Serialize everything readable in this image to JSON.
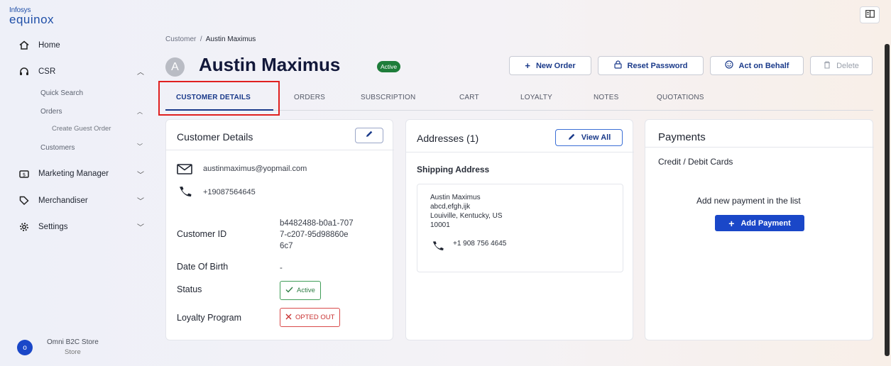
{
  "brand": {
    "line1": "Infosys",
    "line2": "equinox"
  },
  "sidebar": {
    "items": [
      {
        "label": "Home"
      },
      {
        "label": "CSR"
      },
      {
        "label": "Marketing Manager"
      },
      {
        "label": "Merchandiser"
      },
      {
        "label": "Settings"
      }
    ],
    "sub_items": [
      {
        "label": "Quick Search"
      },
      {
        "label": "Orders"
      },
      {
        "label": "Create Guest Order"
      },
      {
        "label": "Customers"
      }
    ],
    "store": {
      "initial": "o",
      "name": "Omni B2C Store",
      "type": "Store"
    }
  },
  "header": {
    "breadcrumb_root": "Customer",
    "breadcrumb_sep": "/",
    "breadcrumb_current": "Austin Maximus",
    "avatar_initial": "A",
    "customer_name": "Austin Maximus",
    "status_badge": "Active",
    "buttons": {
      "new_order": "New Order",
      "reset_password": "Reset Password",
      "act_on_behalf": "Act on Behalf",
      "delete": "Delete"
    }
  },
  "tabs": [
    {
      "label": "CUSTOMER DETAILS",
      "selected": true
    },
    {
      "label": "ORDERS"
    },
    {
      "label": "SUBSCRIPTION"
    },
    {
      "label": "CART"
    },
    {
      "label": "LOYALTY"
    },
    {
      "label": "NOTES"
    },
    {
      "label": "QUOTATIONS"
    }
  ],
  "customer_details": {
    "title": "Customer Details",
    "email": "austinmaximus@yopmail.com",
    "phone": "+19087564645",
    "id_label": "Customer ID",
    "id_line1": "b4482488-b0a1-707",
    "id_line2": "7-c207-95d98860e",
    "id_line3": "6c7",
    "dob_label": "Date Of Birth",
    "dob_value": "-",
    "status_label": "Status",
    "status_value": "Active",
    "loyalty_label": "Loyalty Program",
    "loyalty_value": "OPTED OUT"
  },
  "addresses": {
    "title": "Addresses (1)",
    "view_all": "View All",
    "shipping_label": "Shipping Address",
    "name": "Austin Maximus",
    "line1": "abcd,efgh,ijk",
    "line2": "Louiville, Kentucky, US",
    "zip": "10001",
    "phone": "+1 908 756 4645"
  },
  "payments": {
    "title": "Payments",
    "section": "Credit / Debit Cards",
    "empty_text": "Add new payment in the list",
    "add_button": "Add Payment"
  },
  "colors": {
    "brand_blue": "#1a47c8",
    "title_navy": "#12183a",
    "active_green": "#1e7d3a",
    "highlight_red": "#e02020"
  }
}
